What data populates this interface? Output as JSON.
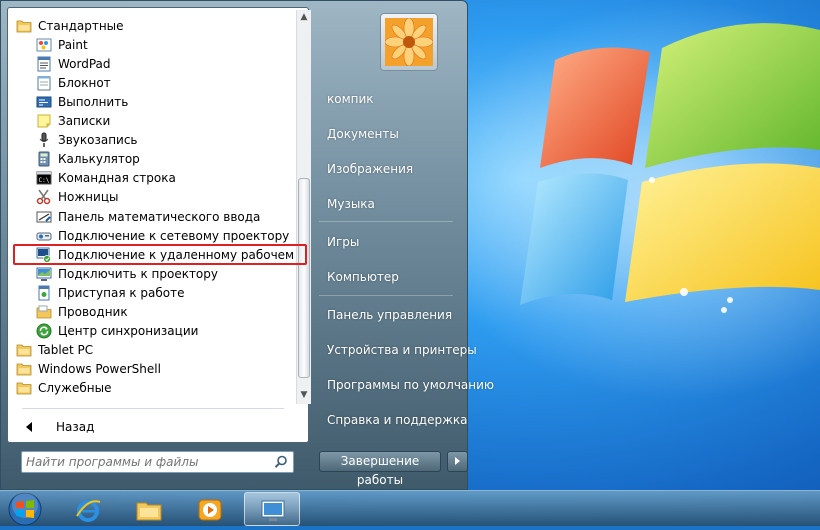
{
  "programs": {
    "items": [
      {
        "label": "Стандартные",
        "icon": "folder-icon",
        "folder": true
      },
      {
        "label": "Paint",
        "icon": "paint-icon"
      },
      {
        "label": "WordPad",
        "icon": "wordpad-icon"
      },
      {
        "label": "Блокнот",
        "icon": "notepad-icon"
      },
      {
        "label": "Выполнить",
        "icon": "run-icon"
      },
      {
        "label": "Записки",
        "icon": "sticky-notes-icon"
      },
      {
        "label": "Звукозапись",
        "icon": "microphone-icon"
      },
      {
        "label": "Калькулятор",
        "icon": "calculator-icon"
      },
      {
        "label": "Командная строка",
        "icon": "command-prompt-icon"
      },
      {
        "label": "Ножницы",
        "icon": "scissors-icon"
      },
      {
        "label": "Панель математического ввода",
        "icon": "math-input-icon"
      },
      {
        "label": "Подключение к сетевому проектору",
        "icon": "network-projector-icon"
      },
      {
        "label": "Подключение к удаленному рабочему столу",
        "icon": "remote-desktop-icon"
      },
      {
        "label": "Подключить к проектору",
        "icon": "projector-icon"
      },
      {
        "label": "Приступая к работе",
        "icon": "getting-started-icon"
      },
      {
        "label": "Проводник",
        "icon": "explorer-icon"
      },
      {
        "label": "Центр синхронизации",
        "icon": "sync-center-icon"
      },
      {
        "label": "Tablet PC",
        "icon": "folder-icon",
        "folder": true
      },
      {
        "label": "Windows PowerShell",
        "icon": "folder-icon",
        "folder": true
      },
      {
        "label": "Служебные",
        "icon": "folder-icon",
        "folder": true
      }
    ],
    "back_label": "Назад"
  },
  "search": {
    "placeholder": "Найти программы и файлы"
  },
  "right_panel": {
    "user": "компик",
    "items": [
      "Документы",
      "Изображения",
      "Музыка",
      "Игры",
      "Компьютер",
      "Панель управления",
      "Устройства и принтеры",
      "Программы по умолчанию",
      "Справка и поддержка"
    ]
  },
  "shutdown": {
    "label": "Завершение работы"
  },
  "colors": {
    "highlight_border": "#e02020",
    "accent": "#1a73c7"
  }
}
